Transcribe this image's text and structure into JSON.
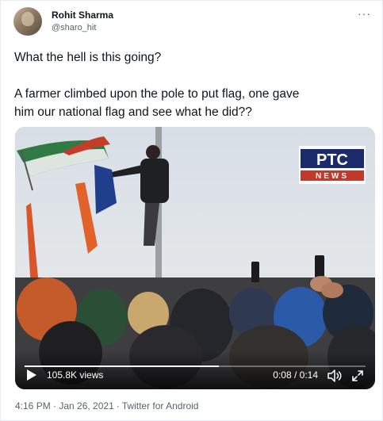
{
  "author": {
    "display_name": "Rohit Sharma",
    "handle": "@sharo_hit"
  },
  "more_icon": "ellipsis-icon",
  "tweet": {
    "line1": "What the hell is this going?",
    "line2": "A farmer climbed upon the pole to put flag, one gave",
    "line3": "him our national flag and see what he did??"
  },
  "video": {
    "watermark_top": "PTC",
    "watermark_bottom": "NEWS",
    "views": "105.8K views",
    "time": "0:08 / 0:14",
    "progress": 0.57,
    "icons": [
      "play-icon",
      "volume-icon",
      "fullscreen-icon"
    ]
  },
  "footer": {
    "timestamp": "4:16 PM · Jan 26, 2021",
    "separator": "·",
    "source": "Twitter for Android"
  },
  "colors": {
    "text": "#0f1419",
    "secondary": "#536471",
    "border": "#e6ecf0"
  }
}
